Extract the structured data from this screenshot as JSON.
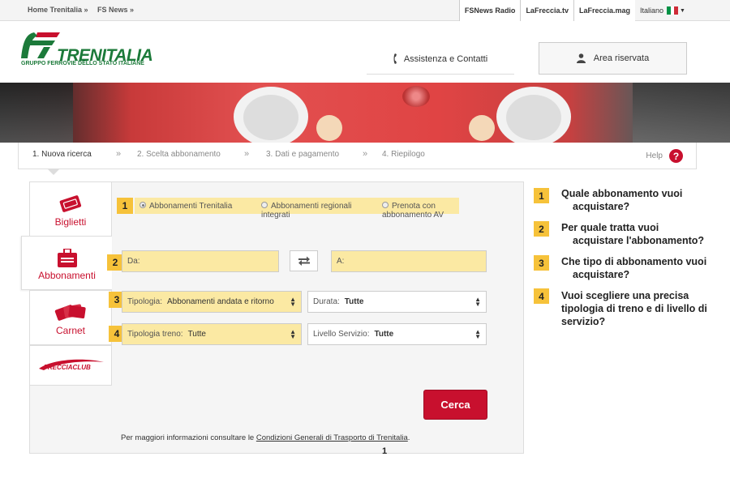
{
  "topbar": {
    "crumbs": [
      "Home Trenitalia »",
      "FS News »"
    ],
    "links": [
      "FSNews Radio",
      "LaFreccia.tv",
      "LaFreccia.mag"
    ],
    "language": "Italiano"
  },
  "header": {
    "logo_text": "TRENITALIA",
    "logo_sub": "GRUPPO FERROVIE DELLO STATO ITALIANE",
    "assist_label": "Assistenza e Contatti",
    "area_label": "Area riservata"
  },
  "steps": {
    "items": [
      "1. Nuova ricerca",
      "2. Scelta abbonamento",
      "3. Dati e pagamento",
      "4. Riepilogo"
    ],
    "separator": "»",
    "help_label": "Help",
    "help_icon": "?"
  },
  "tabs": [
    {
      "label": "Biglietti",
      "icon": "ticket-icon"
    },
    {
      "label": "Abbonamenti",
      "icon": "pass-icon"
    },
    {
      "label": "Carnet",
      "icon": "carnet-icon"
    },
    {
      "label": "FRECCIACLUB",
      "icon": "frecciaclub-logo"
    }
  ],
  "form": {
    "radios": [
      {
        "label_line1": "Abbonamenti Trenitalia",
        "label_line2": "",
        "selected": true
      },
      {
        "label_line1": "Abbonamenti regionali",
        "label_line2": "integrati",
        "selected": false
      },
      {
        "label_line1": "Prenota con",
        "label_line2": "abbonamento AV",
        "selected": false
      }
    ],
    "from_label": "Da:",
    "to_label": "A:",
    "tipologia_label": "Tipologia:",
    "tipologia_value": "Abbonamenti andata e ritorno",
    "durata_label": "Durata:",
    "durata_value": "Tutte",
    "tipologia_treno_label": "Tipologia treno:",
    "tipologia_treno_value": "Tutte",
    "livello_label": "Livello Servizio:",
    "livello_value": "Tutte",
    "search_button": "Cerca",
    "info_prefix": "Per maggiori informazioni consultare le ",
    "info_link": "Condizioni Generali di Trasporto di Trenitalia",
    "info_suffix": "."
  },
  "markers": [
    "1",
    "2",
    "3",
    "4"
  ],
  "questions": [
    {
      "num": "1",
      "line1": "Quale abbonamento vuoi",
      "line2": "acquistare?"
    },
    {
      "num": "2",
      "line1": "Per quale tratta vuoi",
      "line2": "acquistare l'abbonamento?"
    },
    {
      "num": "3",
      "line1": "Che tipo di abbonamento vuoi",
      "line2": "acquistare?"
    },
    {
      "num": "4",
      "line1": "Vuoi scegliere una precisa",
      "line2": "tipologia di treno e di livello di",
      "line3": "servizio?"
    }
  ],
  "page_number": "1",
  "colors": {
    "brand_red": "#c8102e",
    "brand_green": "#1c7a3a",
    "highlight": "#f6c23a"
  }
}
